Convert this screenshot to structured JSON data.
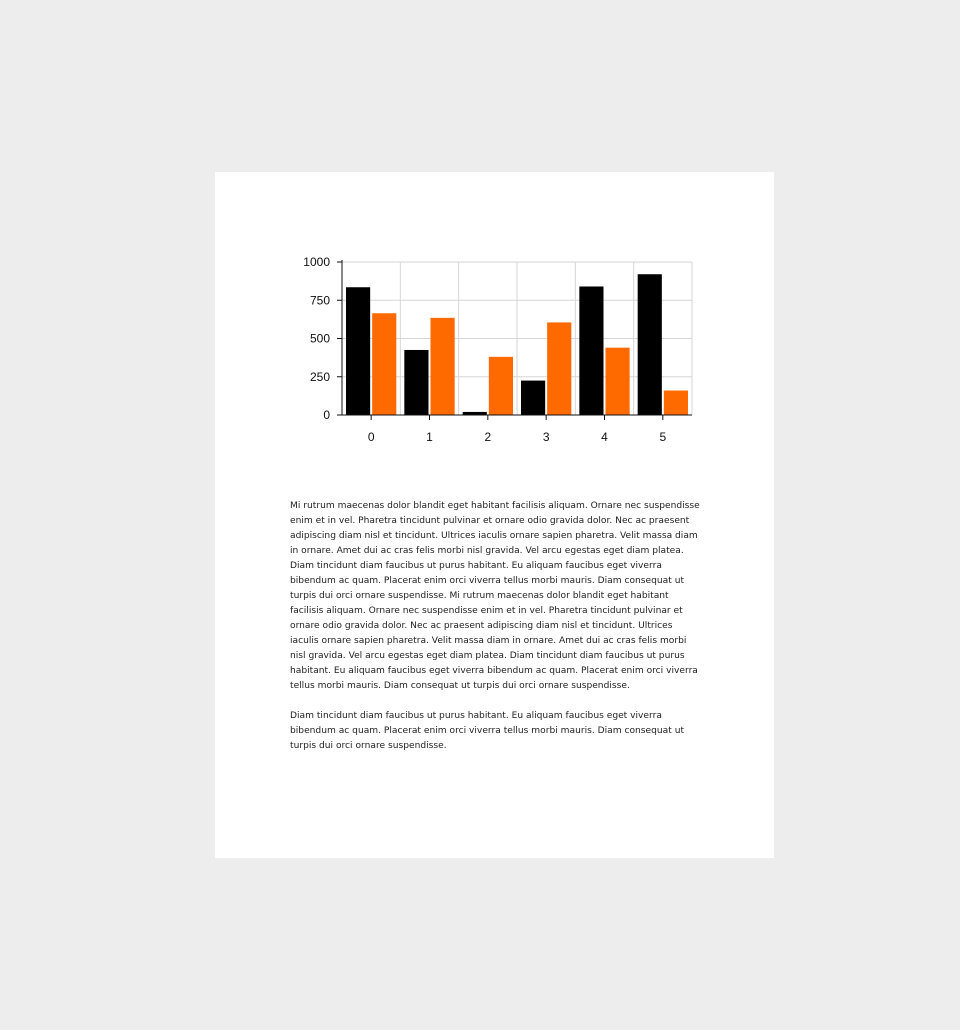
{
  "chart_data": {
    "type": "bar",
    "categories": [
      "0",
      "1",
      "2",
      "3",
      "4",
      "5"
    ],
    "series": [
      {
        "color": "#000000",
        "values": [
          835,
          425,
          20,
          225,
          840,
          920
        ]
      },
      {
        "color": "#ff6a00",
        "values": [
          665,
          635,
          380,
          605,
          440,
          160
        ]
      }
    ],
    "ylim": [
      0,
      1000
    ],
    "yticks": [
      0,
      250,
      500,
      750,
      1000
    ],
    "grid": true,
    "title": "",
    "xlabel": "",
    "ylabel": ""
  },
  "paragraphs": [
    "Mi rutrum maecenas dolor blandit eget habitant facilisis aliquam. Ornare nec suspendisse enim et in vel. Pharetra tincidunt pulvinar et ornare odio gravida dolor. Nec ac praesent adipiscing diam nisl et tincidunt. Ultrices iaculis ornare sapien pharetra. Velit massa diam in ornare. Amet dui ac cras felis morbi nisl gravida. Vel arcu egestas eget diam platea. Diam tincidunt diam faucibus ut purus habitant. Eu aliquam faucibus eget viverra bibendum ac quam. Placerat enim orci viverra tellus morbi mauris. Diam consequat ut turpis dui orci ornare suspendisse. Mi rutrum maecenas dolor blandit eget habitant facilisis aliquam. Ornare nec suspendisse enim et in vel. Pharetra tincidunt pulvinar et ornare odio gravida dolor. Nec ac praesent adipiscing diam nisl et tincidunt. Ultrices iaculis ornare sapien pharetra. Velit massa diam in ornare. Amet dui ac cras felis morbi nisl gravida. Vel arcu egestas eget diam platea. Diam tincidunt diam faucibus ut purus habitant. Eu aliquam faucibus eget viverra bibendum ac quam. Placerat enim orci viverra tellus morbi mauris. Diam consequat ut turpis dui orci ornare suspendisse.",
    "Diam tincidunt diam faucibus ut purus habitant. Eu aliquam faucibus eget viverra bibendum ac quam. Placerat enim orci viverra tellus morbi mauris. Diam consequat ut turpis dui orci ornare suspendisse."
  ]
}
